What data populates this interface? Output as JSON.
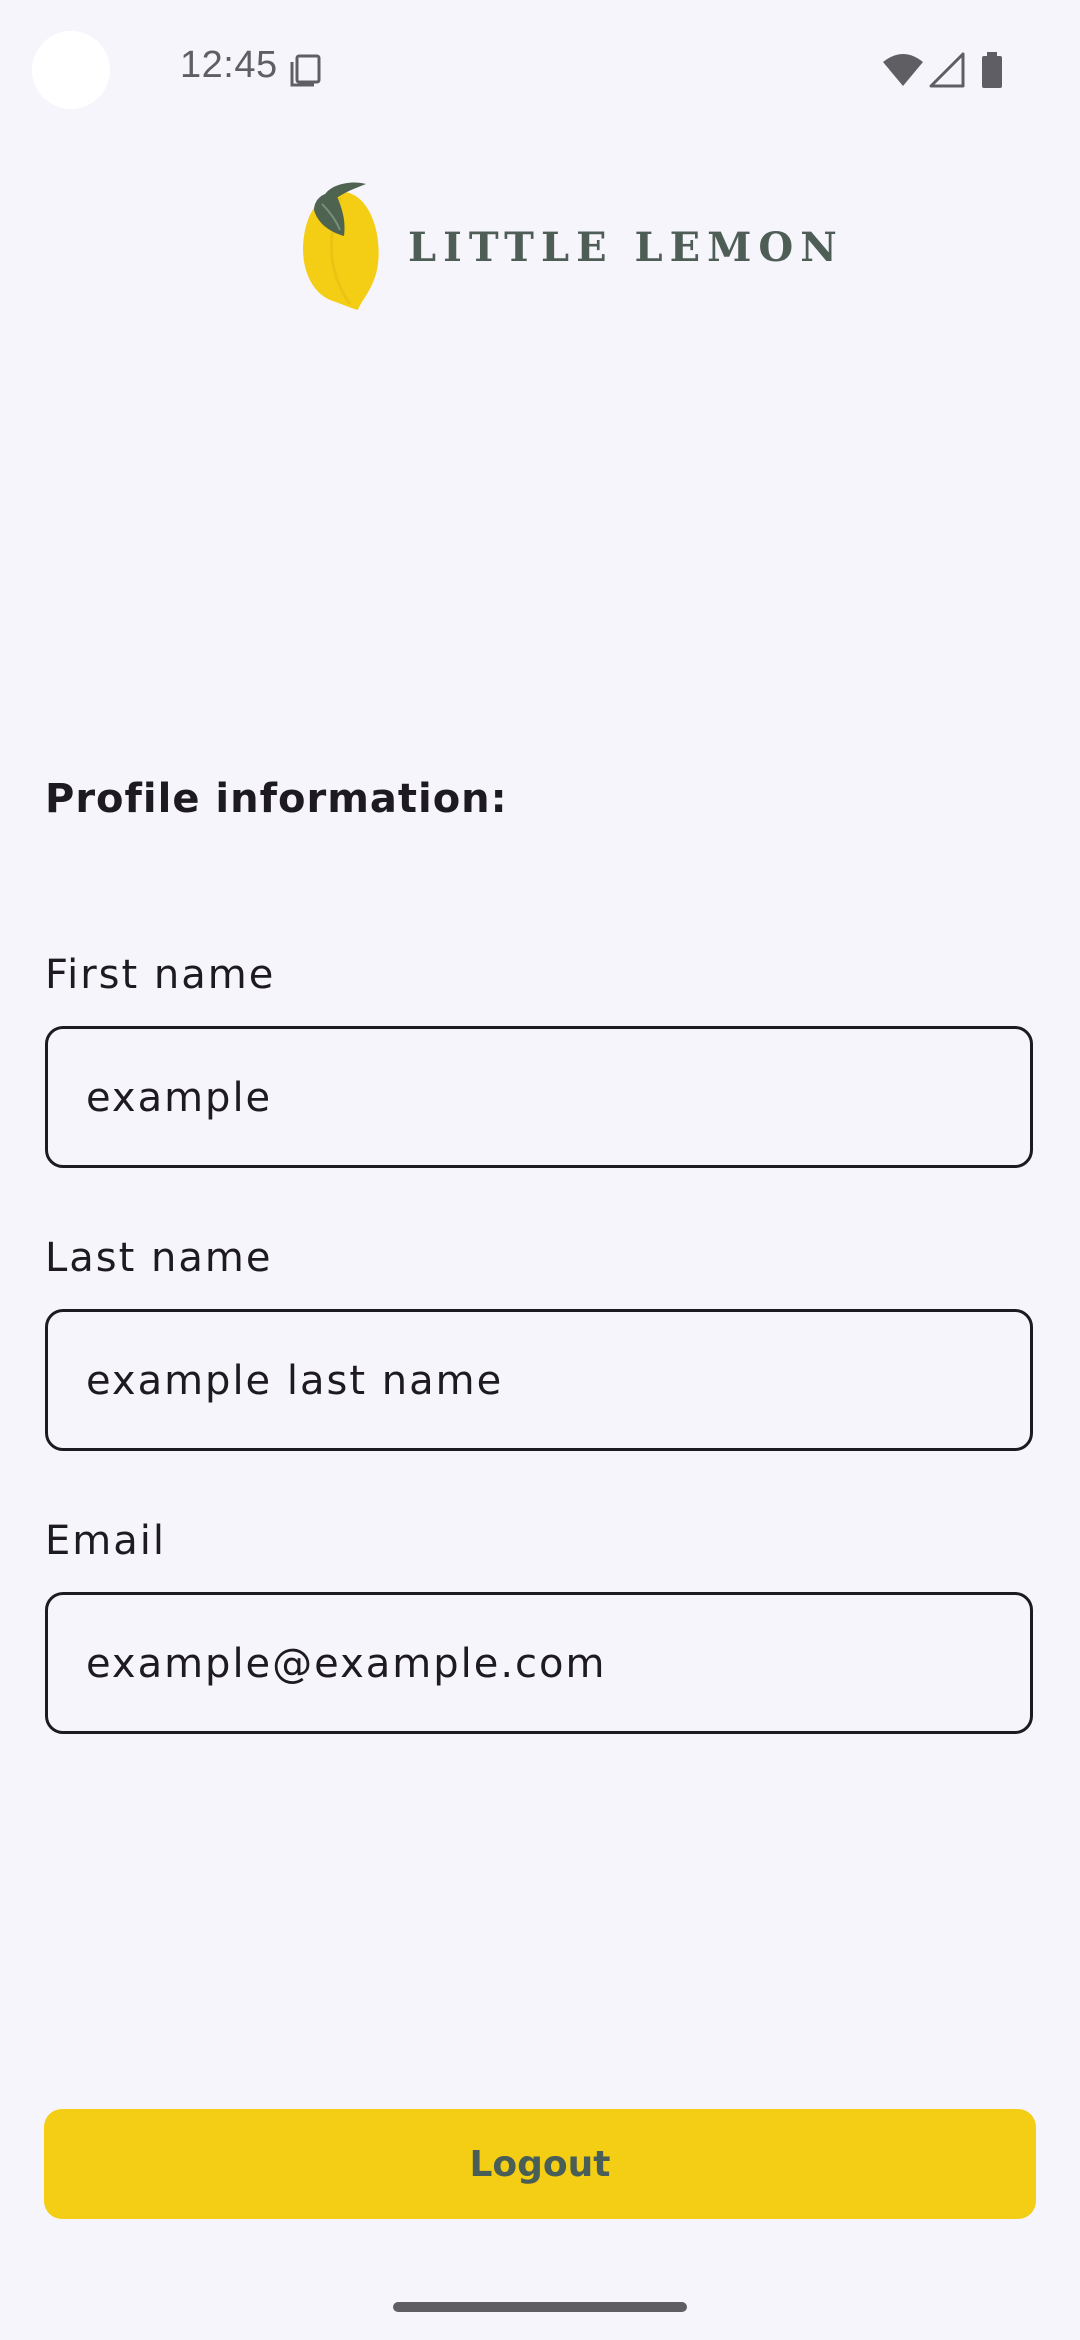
{
  "status_bar": {
    "time": "12:45",
    "icons": [
      "sim-card-icon",
      "wifi-icon",
      "cell-signal-icon",
      "battery-icon"
    ]
  },
  "logo": {
    "text": "LITTLE LEMON"
  },
  "profile": {
    "title": "Profile information:",
    "fields": [
      {
        "label": "First name",
        "value": "example"
      },
      {
        "label": "Last name",
        "value": "example last name"
      },
      {
        "label": "Email",
        "value": "example@example.com"
      }
    ]
  },
  "actions": {
    "logout_label": "Logout"
  },
  "colors": {
    "background": "#f7f5fc",
    "accent_yellow": "#f4ce14",
    "brand_green": "#495e57",
    "text": "#1d1b20"
  }
}
